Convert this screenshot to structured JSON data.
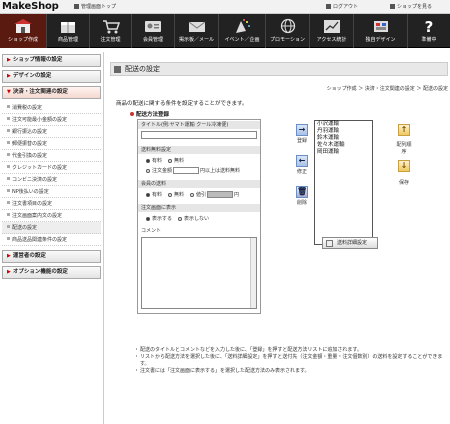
{
  "header": {
    "logo": "MakeShop",
    "admin_top": "管理画面トップ",
    "logout": "ログアウト",
    "to_shop": "ショップを見る"
  },
  "nav": [
    {
      "label": "ショップ作成",
      "icon": "shop-icon",
      "active": true
    },
    {
      "label": "商品管理",
      "icon": "box-icon",
      "active": false
    },
    {
      "label": "注文管理",
      "icon": "cart-icon",
      "active": false
    },
    {
      "label": "会員管理",
      "icon": "member-card-icon",
      "active": false
    },
    {
      "label": "掲示板／メール",
      "icon": "board-mail-icon",
      "active": false
    },
    {
      "label": "イベント／企画",
      "icon": "party-icon",
      "active": false
    },
    {
      "label": "プロモーション",
      "icon": "globe-icon",
      "active": false
    },
    {
      "label": "アクセス統計",
      "icon": "chart-icon",
      "active": false
    },
    {
      "label": "独自デザイン",
      "icon": "palette-icon",
      "active": false
    },
    {
      "label": "準備中",
      "icon": "question-icon",
      "active": false
    }
  ],
  "sidebar": {
    "sections_top": [
      "ショップ情報の設定",
      "デザインの設定"
    ],
    "open_section": "決済・注文関連の設定",
    "items": [
      "消費税の設定",
      "注文可能最小金額の設定",
      "銀行振込の設定",
      "郵便振替の設定",
      "代金引換の設定",
      "クレジットカードの設定",
      "コンビニ決済の設定",
      "NP後払いの設定",
      "注文書項目の設定",
      "注文画面案内文の設定",
      "配送の設定",
      "商品送品関連条件の設定"
    ],
    "current_item_index": 10,
    "sections_bottom": [
      "運営者の設定",
      "オプション機能の設定"
    ]
  },
  "main": {
    "page_title": "配送の設定",
    "breadcrumb": "ショップ作成 ＞ 決済・注文関連の設定 ＞ 配送の設定",
    "description": "商品の配送に関する条件を設定することができます。",
    "section_title": "配送方法登録",
    "form": {
      "title_label": "タイトル(例:ヤマト運輸 クール冷凍便)",
      "free_shipping_label": "送料無料設定",
      "opt_yes": "有料",
      "opt_free": "無料",
      "opt_order_amount": "注文金額",
      "free_over_suffix": "円以上は送料無料",
      "member_price_label": "会員の送料",
      "opt_discount": "値引",
      "yen": "円",
      "order_display_label": "注文画面に表示",
      "opt_show": "表示する",
      "opt_hide": "表示しない",
      "comment_label": "コメント"
    },
    "buttons": {
      "register": "登録",
      "modify": "修正",
      "delete": "削除",
      "reorder": "配列順序",
      "save": "保存",
      "shipping_detail": "送料詳細設定"
    },
    "carriers": [
      "小沢運輸",
      "丹羽運輸",
      "鈴木運輸",
      "佐々木運輸",
      "岡田運輸"
    ],
    "notes": [
      "配送のタイトルとコメントなどを入力した後に、「登録」を押すと配送方法リストに追加されます。",
      "リストから配送方法を選択した後に、「送料詳細設定」を押すと送付先（注文金額・重量・注文個数別）の送料を設定することができます。",
      "注文書には「注文画面に表示する」を選択した配送方法のみ表示されます。"
    ]
  }
}
